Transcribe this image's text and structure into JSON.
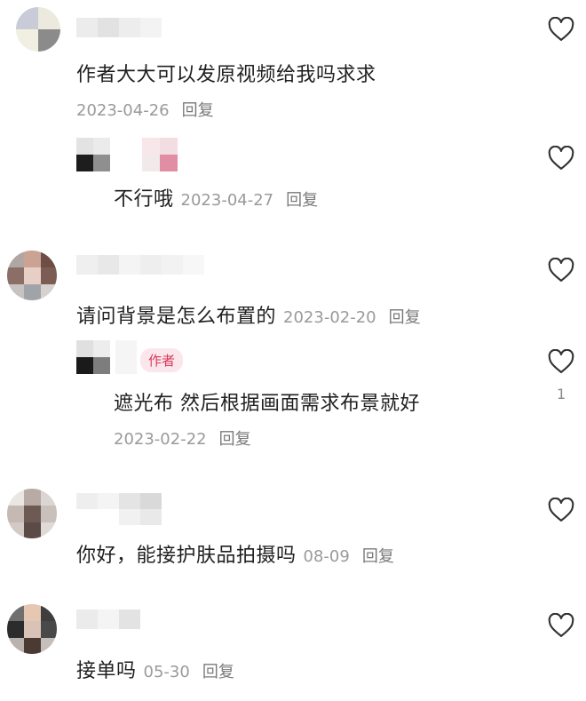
{
  "comments": [
    {
      "text": "作者大大可以发原视频给我吗求求",
      "date": "2023-04-26",
      "reply_label": "回复",
      "replies": [
        {
          "text": "不行哦",
          "date": "2023-04-27",
          "reply_label": "回复"
        }
      ]
    },
    {
      "text": "请问背景是怎么布置的",
      "date": "2023-02-20",
      "reply_label": "回复",
      "replies": [
        {
          "badge": "作者",
          "text": "遮光布 然后根据画面需求布景就好",
          "date": "2023-02-22",
          "reply_label": "回复",
          "like_count": "1"
        }
      ]
    },
    {
      "text": "你好，能接护肤品拍摄吗",
      "date": "08-09",
      "reply_label": "回复"
    },
    {
      "text": "接单吗",
      "date": "05-30",
      "reply_label": "回复"
    }
  ],
  "icons": {
    "like": "heart-outline-icon"
  },
  "colors": {
    "author_badge_text": "#d8385a",
    "author_badge_bg": "#fbe6ec",
    "meta": "#9a9a9a"
  }
}
